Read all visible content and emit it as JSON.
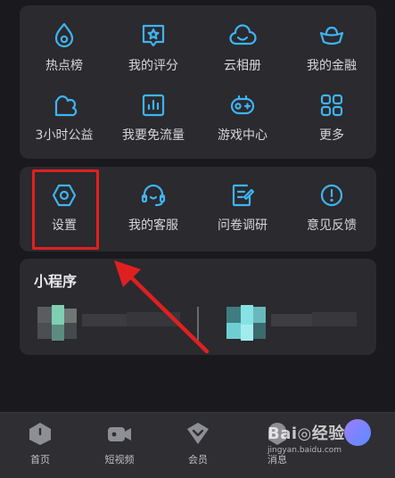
{
  "services": {
    "row1": [
      {
        "label": "热点榜",
        "icon": "flame-icon"
      },
      {
        "label": "我的评分",
        "icon": "rating-star-icon"
      },
      {
        "label": "云相册",
        "icon": "cloud-album-icon"
      },
      {
        "label": "我的金融",
        "icon": "gold-ingot-icon"
      }
    ],
    "row2": [
      {
        "label": "3小时公益",
        "icon": "charity-leaf-icon"
      },
      {
        "label": "我要免流量",
        "icon": "data-bars-icon"
      },
      {
        "label": "游戏中心",
        "icon": "game-controller-icon"
      },
      {
        "label": "更多",
        "icon": "more-grid-icon"
      }
    ]
  },
  "tools": [
    {
      "label": "设置",
      "icon": "settings-hexagon-icon"
    },
    {
      "label": "我的客服",
      "icon": "headset-icon"
    },
    {
      "label": "问卷调研",
      "icon": "survey-pen-icon"
    },
    {
      "label": "意见反馈",
      "icon": "feedback-exclamation-icon"
    }
  ],
  "mini_programs": {
    "title": "小程序"
  },
  "tabbar": [
    {
      "label": "首页",
      "icon": "home-icon"
    },
    {
      "label": "短视频",
      "icon": "video-camera-icon"
    },
    {
      "label": "会员",
      "icon": "member-heart-icon"
    },
    {
      "label": "消息",
      "icon": "message-icon"
    }
  ],
  "watermark": {
    "main": "Bai◎经验",
    "sub": "jingyan.baidu.com"
  },
  "colors": {
    "accent": "#3fb4f1",
    "highlight": "#e02020",
    "background": "#1a1a1e",
    "card": "#2a2a2f"
  }
}
